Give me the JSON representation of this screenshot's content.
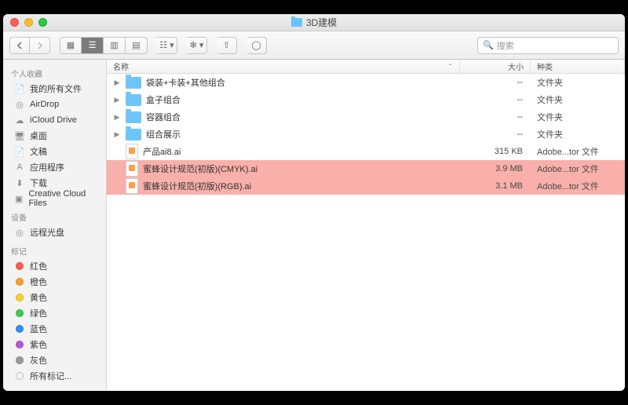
{
  "window": {
    "title": "3D建模"
  },
  "toolbar": {
    "search_placeholder": "搜索"
  },
  "sidebar": {
    "sections": [
      {
        "header": "个人收藏",
        "items": [
          {
            "icon": "📄",
            "label": "我的所有文件"
          },
          {
            "icon": "◎",
            "label": "AirDrop"
          },
          {
            "icon": "☁",
            "label": "iCloud Drive"
          },
          {
            "icon": "🖥",
            "label": "桌面"
          },
          {
            "icon": "📄",
            "label": "文稿"
          },
          {
            "icon": "A",
            "label": "应用程序"
          },
          {
            "icon": "⬇",
            "label": "下载"
          },
          {
            "icon": "▣",
            "label": "Creative Cloud Files"
          }
        ]
      },
      {
        "header": "设备",
        "items": [
          {
            "icon": "◎",
            "label": "远程光盘"
          }
        ]
      },
      {
        "header": "标记",
        "items": [
          {
            "color": "#ff5b51",
            "label": "红色"
          },
          {
            "color": "#fd9f2b",
            "label": "橙色"
          },
          {
            "color": "#fdd02c",
            "label": "黄色"
          },
          {
            "color": "#3ecb4f",
            "label": "绿色"
          },
          {
            "color": "#2e8efb",
            "label": "蓝色"
          },
          {
            "color": "#b857d8",
            "label": "紫色"
          },
          {
            "color": "#9b9b9b",
            "label": "灰色"
          },
          {
            "color": "",
            "label": "所有标记..."
          }
        ]
      }
    ]
  },
  "columns": {
    "name": "名称",
    "size": "大小",
    "kind": "种类"
  },
  "files": [
    {
      "type": "folder",
      "name": "袋装+卡装+其他组合",
      "size": "--",
      "kind": "文件夹",
      "selected": false
    },
    {
      "type": "folder",
      "name": "盒子组合",
      "size": "--",
      "kind": "文件夹",
      "selected": false
    },
    {
      "type": "folder",
      "name": "容器组合",
      "size": "--",
      "kind": "文件夹",
      "selected": false
    },
    {
      "type": "folder",
      "name": "组合展示",
      "size": "--",
      "kind": "文件夹",
      "selected": false
    },
    {
      "type": "ai",
      "name": "产品ai8.ai",
      "size": "315 KB",
      "kind": "Adobe...tor 文件",
      "selected": false
    },
    {
      "type": "ai",
      "name": "蜜蜂设计规范(初版)(CMYK).ai",
      "size": "3.9 MB",
      "kind": "Adobe...tor 文件",
      "selected": true
    },
    {
      "type": "ai",
      "name": "蜜蜂设计规范(初版)(RGB).ai",
      "size": "3.1 MB",
      "kind": "Adobe...tor 文件",
      "selected": true
    }
  ]
}
